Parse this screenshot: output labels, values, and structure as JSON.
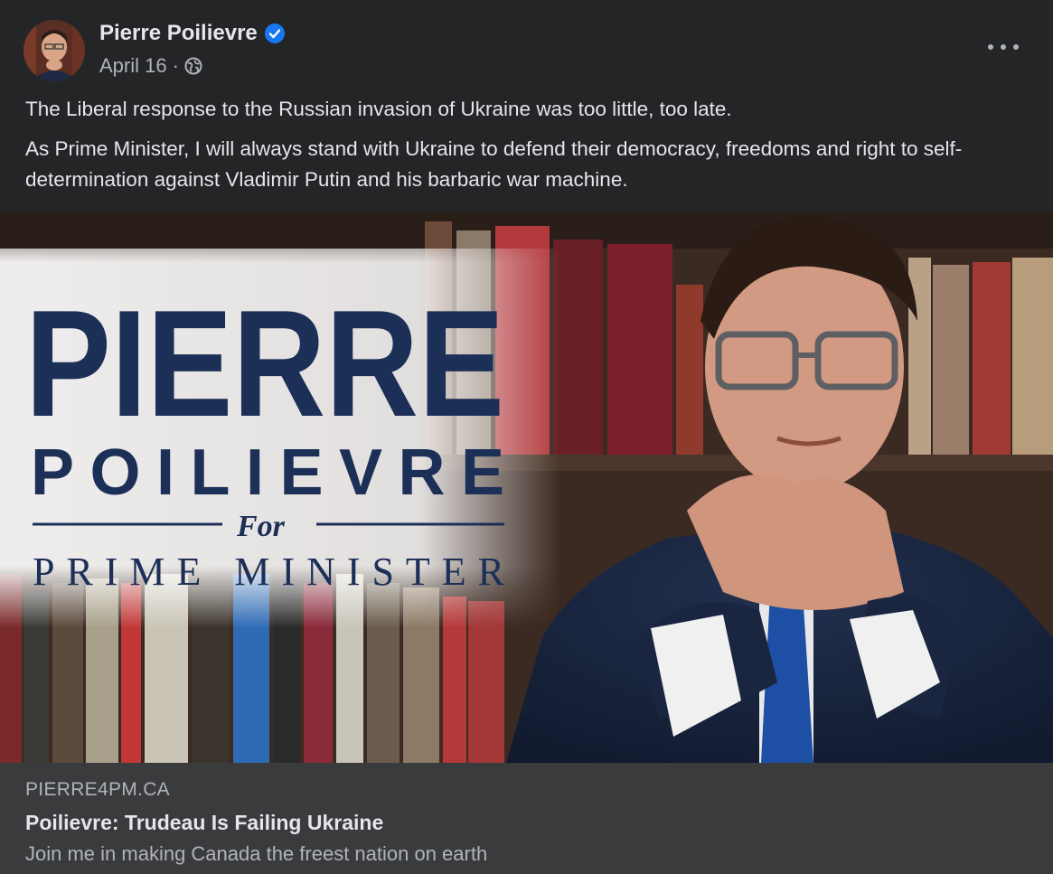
{
  "post": {
    "author": "Pierre Poilievre",
    "date": "April 16",
    "separator": "·",
    "privacy_icon": "globe-icon",
    "verified_icon": "verified-badge-icon",
    "more_icon": "more-horizontal-icon",
    "paragraphs": [
      "The Liberal response to the Russian invasion of Ukraine was too little, too late.",
      "As Prime Minister, I will always stand with Ukraine to defend their democracy, freedoms and right to self-determination against Vladimir Putin and his barbaric war machine."
    ]
  },
  "image": {
    "headline_first": "PIERRE",
    "headline_last": "POILIEVRE",
    "for_text": "For",
    "subtitle": "PRIME MINISTER"
  },
  "link": {
    "domain": "PIERRE4PM.CA",
    "title": "Poilievre: Trudeau Is Failing Ukraine",
    "description": "Join me in making Canada the freest nation on earth"
  },
  "colors": {
    "background": "#242526",
    "card": "#3a3b3c",
    "verified": "#1877f2",
    "brand_navy": "#1c2f57"
  }
}
